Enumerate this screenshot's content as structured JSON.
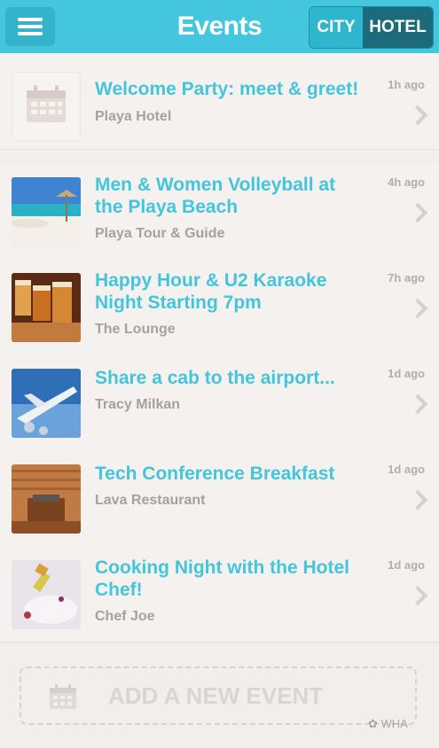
{
  "header": {
    "title": "Events",
    "toggle": {
      "city_label": "CITY",
      "hotel_label": "HOTEL",
      "selected": "HOTEL"
    }
  },
  "events": [
    {
      "title": "Welcome Party: meet & greet!",
      "subtitle": "Playa Hotel",
      "time": "1h ago",
      "thumb": "calendar-placeholder"
    },
    {
      "title": "Men & Women Volleyball at the Playa Beach",
      "subtitle": "Playa Tour & Guide",
      "time": "4h ago",
      "thumb": "beach"
    },
    {
      "title": "Happy Hour & U2 Karaoke Night Starting 7pm",
      "subtitle": "The Lounge",
      "time": "7h ago",
      "thumb": "beer-glasses"
    },
    {
      "title": "Share a cab to the airport...",
      "subtitle": "Tracy Milkan",
      "time": "1d ago",
      "thumb": "airplane"
    },
    {
      "title": "Tech Conference Breakfast",
      "subtitle": "Lava Restaurant",
      "time": "1d ago",
      "thumb": "sauna-room"
    },
    {
      "title": "Cooking Night with the Hotel Chef!",
      "subtitle": "Chef Joe",
      "time": "1d ago",
      "thumb": "wine-dinner"
    }
  ],
  "add_event": {
    "label": "ADD A NEW EVENT"
  },
  "watermark": "WHA",
  "colors": {
    "accent": "#44c7de",
    "selected_toggle": "#1d6a7d",
    "subtitle": "#a6a19e"
  }
}
